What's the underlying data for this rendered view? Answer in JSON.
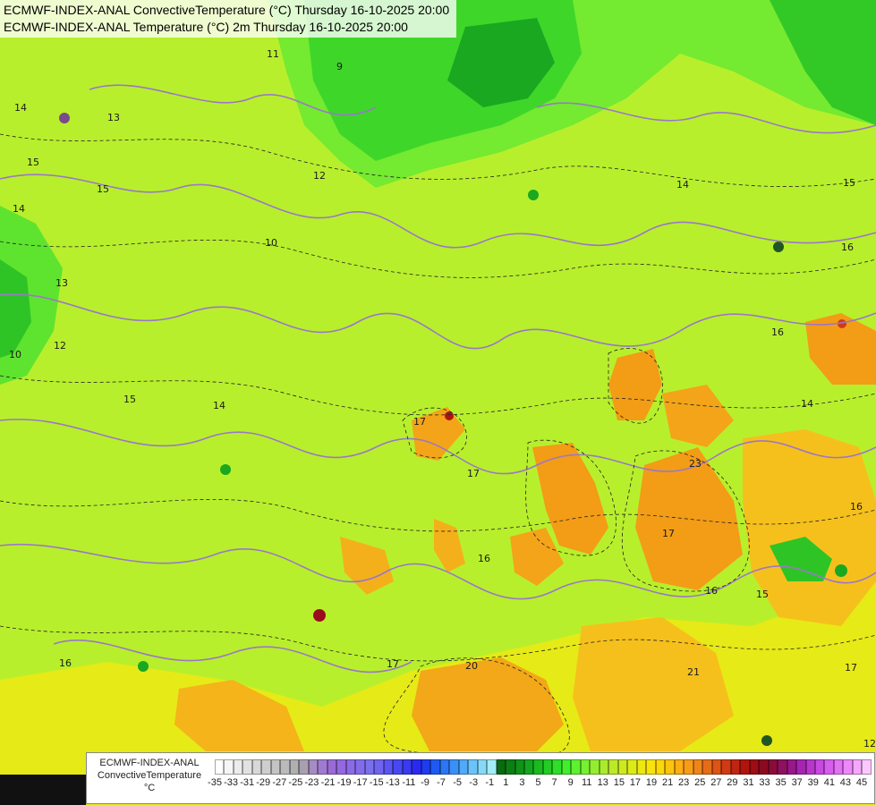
{
  "titles": {
    "line1": "ECMWF-INDEX-ANAL ConvectiveTemperature (°C) Thursday 16-10-2025 20:00",
    "line2": "ECMWF-INDEX-ANAL Temperature (°C) 2m Thursday 16-10-2025 20:00"
  },
  "legend": {
    "name_line1": "ECMWF-INDEX-ANAL",
    "name_line2": "ConvectiveTemperature",
    "unit": "°C",
    "tick_labels": [
      "-35",
      "-33",
      "-31",
      "-29",
      "-27",
      "-25",
      "-23",
      "-21",
      "-19",
      "-17",
      "-15",
      "-13",
      "-11",
      "-9",
      "-7",
      "-5",
      "-3",
      "-1",
      "1",
      "3",
      "5",
      "7",
      "9",
      "11",
      "13",
      "15",
      "17",
      "19",
      "21",
      "23",
      "25",
      "27",
      "29",
      "31",
      "33",
      "35",
      "37",
      "39",
      "41",
      "43",
      "45"
    ],
    "colors": [
      "#ffffff",
      "#f6f6f6",
      "#ececec",
      "#e2e2e2",
      "#d8d8d8",
      "#cecece",
      "#c4c4c4",
      "#bababa",
      "#b0b0b0",
      "#a8a0b0",
      "#a58cc3",
      "#a07ad0",
      "#9a6ad8",
      "#9468e0",
      "#8c6ae6",
      "#826ceb",
      "#7a70ee",
      "#6e64f0",
      "#5c54f2",
      "#4848f2",
      "#3a3af0",
      "#2a2aee",
      "#1e3cf0",
      "#1e5af2",
      "#2a76f4",
      "#3a90f6",
      "#50aaf8",
      "#6ac4fa",
      "#86daf8",
      "#a2ecf6",
      "#0a6a10",
      "#0c7e14",
      "#109218",
      "#14a61c",
      "#1aba20",
      "#22cc24",
      "#2ede28",
      "#42ee2c",
      "#5cf230",
      "#78f032",
      "#94ee30",
      "#aaec2c",
      "#bcea28",
      "#ccea20",
      "#dcea18",
      "#ece810",
      "#f8e40a",
      "#fcd808",
      "#fcc40c",
      "#fcae12",
      "#f89c18",
      "#f08418",
      "#e66c18",
      "#dc5416",
      "#d03a14",
      "#c22412",
      "#b01410",
      "#9e0c14",
      "#8c0a20",
      "#8a0c3c",
      "#8e1060",
      "#98188a",
      "#a824b0",
      "#b836cc",
      "#c848e2",
      "#d85cee",
      "#e470f6",
      "#ee88fa",
      "#f4a8fc",
      "#fac8fe"
    ]
  },
  "contour_labels": [
    "14",
    "15",
    "11",
    "9",
    "10",
    "12",
    "14",
    "15",
    "16",
    "13",
    "14",
    "15",
    "16",
    "17",
    "17",
    "15",
    "14",
    "12",
    "10",
    "16",
    "17",
    "20",
    "21",
    "23",
    "16",
    "16",
    "12",
    "15",
    "13",
    "17",
    "16",
    "14",
    "17"
  ]
}
